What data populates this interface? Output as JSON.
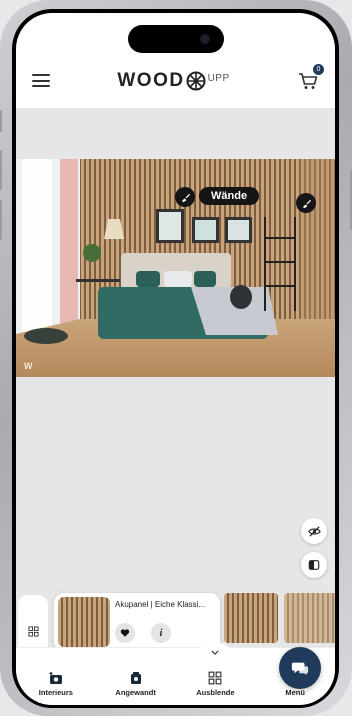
{
  "header": {
    "brand_main": "WOOD",
    "brand_suffix": "UPP",
    "cart_count": "0"
  },
  "viewer": {
    "surface_label": "Wände",
    "watermark": "W"
  },
  "product": {
    "name": "Akupanel | Eiche Klassi...",
    "favorite_icon": "heart-icon",
    "info_label": "i"
  },
  "nav": {
    "items": [
      {
        "label": "Interieurs",
        "icon": "add-photo-icon"
      },
      {
        "label": "Angewandt",
        "icon": "applied-icon"
      },
      {
        "label": "Ausblende",
        "icon": "grid-icon"
      },
      {
        "label": "Menü",
        "icon": "menu-icon"
      }
    ]
  },
  "colors": {
    "accent": "#1f3a5a",
    "pin": "#151515",
    "background": "#e6e6e8"
  }
}
